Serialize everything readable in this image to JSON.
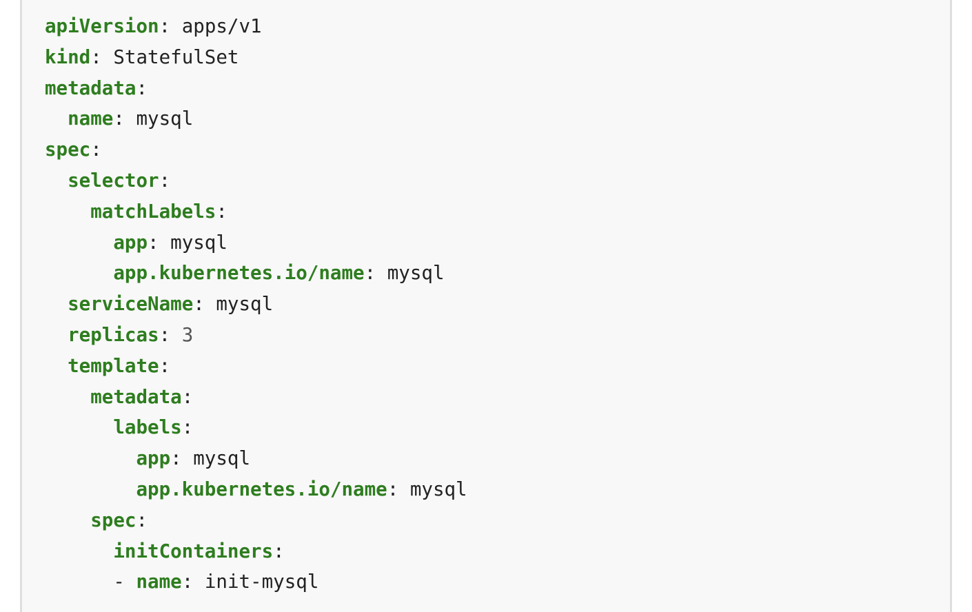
{
  "code": {
    "lines": [
      {
        "indent": "",
        "dash": "",
        "key": "apiVersion",
        "value": "apps/v1",
        "value_type": "string"
      },
      {
        "indent": "",
        "dash": "",
        "key": "kind",
        "value": "StatefulSet",
        "value_type": "string"
      },
      {
        "indent": "",
        "dash": "",
        "key": "metadata",
        "value": "",
        "value_type": "string"
      },
      {
        "indent": "  ",
        "dash": "",
        "key": "name",
        "value": "mysql",
        "value_type": "string"
      },
      {
        "indent": "",
        "dash": "",
        "key": "spec",
        "value": "",
        "value_type": "string"
      },
      {
        "indent": "  ",
        "dash": "",
        "key": "selector",
        "value": "",
        "value_type": "string"
      },
      {
        "indent": "    ",
        "dash": "",
        "key": "matchLabels",
        "value": "",
        "value_type": "string"
      },
      {
        "indent": "      ",
        "dash": "",
        "key": "app",
        "value": "mysql",
        "value_type": "string"
      },
      {
        "indent": "      ",
        "dash": "",
        "key": "app.kubernetes.io/name",
        "value": "mysql",
        "value_type": "string"
      },
      {
        "indent": "  ",
        "dash": "",
        "key": "serviceName",
        "value": "mysql",
        "value_type": "string"
      },
      {
        "indent": "  ",
        "dash": "",
        "key": "replicas",
        "value": "3",
        "value_type": "number"
      },
      {
        "indent": "  ",
        "dash": "",
        "key": "template",
        "value": "",
        "value_type": "string"
      },
      {
        "indent": "    ",
        "dash": "",
        "key": "metadata",
        "value": "",
        "value_type": "string"
      },
      {
        "indent": "      ",
        "dash": "",
        "key": "labels",
        "value": "",
        "value_type": "string"
      },
      {
        "indent": "        ",
        "dash": "",
        "key": "app",
        "value": "mysql",
        "value_type": "string"
      },
      {
        "indent": "        ",
        "dash": "",
        "key": "app.kubernetes.io/name",
        "value": "mysql",
        "value_type": "string"
      },
      {
        "indent": "    ",
        "dash": "",
        "key": "spec",
        "value": "",
        "value_type": "string"
      },
      {
        "indent": "      ",
        "dash": "",
        "key": "initContainers",
        "value": "",
        "value_type": "string"
      },
      {
        "indent": "      ",
        "dash": "- ",
        "key": "name",
        "value": "init-mysql",
        "value_type": "string"
      }
    ]
  },
  "colors": {
    "key": "#2e7d1f",
    "text": "#222222",
    "number": "#555555",
    "background": "#f8f8f8",
    "border": "#dedede"
  }
}
